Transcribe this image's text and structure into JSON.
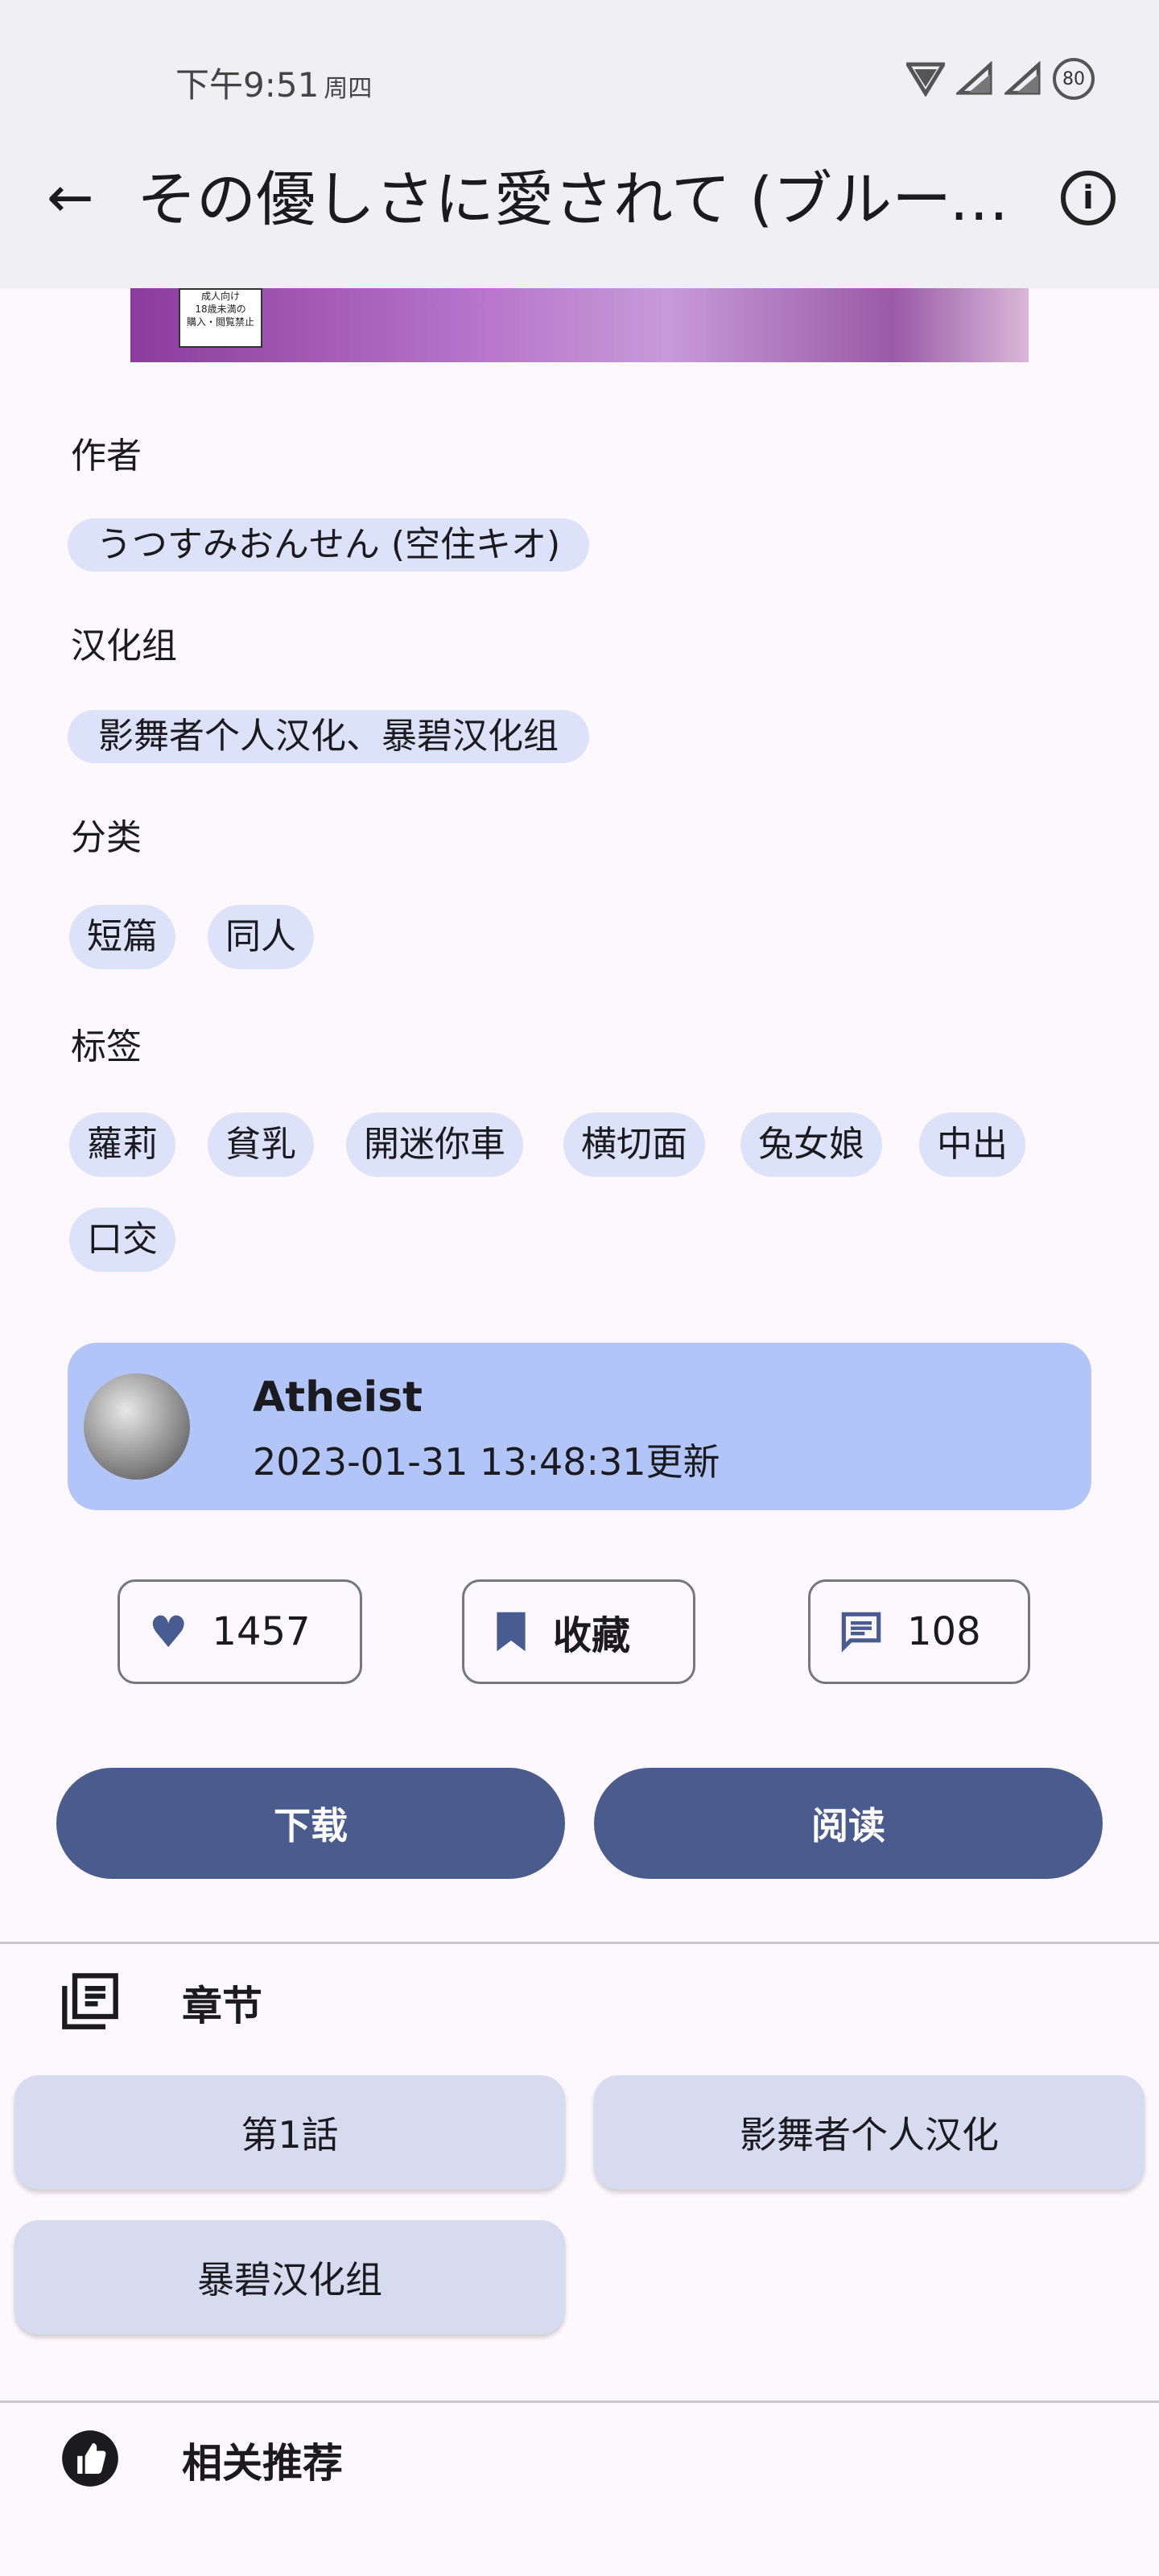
{
  "status_bar": {
    "time": "下午9:51",
    "day": "周四",
    "battery": "80"
  },
  "header": {
    "back_icon": "arrow-left",
    "title": "その優しさに愛されて (ブルーア...",
    "info_icon": "info"
  },
  "cover": {
    "badge_line1": "成人向け",
    "badge_line2": "18歳未満の",
    "badge_line3": "購入・閲覧禁止"
  },
  "details": {
    "author_label": "作者",
    "author": "うつすみおんせん (空住キオ)",
    "group_label": "汉化组",
    "group": "影舞者个人汉化、暴碧汉化组",
    "category_label": "分类",
    "categories": [
      "短篇",
      "同人"
    ],
    "tags_label": "标签",
    "tags": [
      "蘿莉",
      "貧乳",
      "開迷你車",
      "横切面",
      "兔女娘",
      "中出",
      "口交"
    ]
  },
  "uploader": {
    "name": "Atheist",
    "updated": "2023-01-31 13:48:31更新"
  },
  "stats": {
    "likes": "1457",
    "favorite_label": "收藏",
    "comments": "108"
  },
  "actions": {
    "download": "下载",
    "read": "阅读"
  },
  "chapters": {
    "title": "章节",
    "items": [
      "第1話",
      "影舞者个人汉化",
      "暴碧汉化组"
    ]
  },
  "related": {
    "title": "相关推荐"
  },
  "colors": {
    "primary": "#4A5C8E",
    "chip": "#DCE2F9",
    "card": "#B2C5F8",
    "chapter": "#D6DBEF"
  }
}
